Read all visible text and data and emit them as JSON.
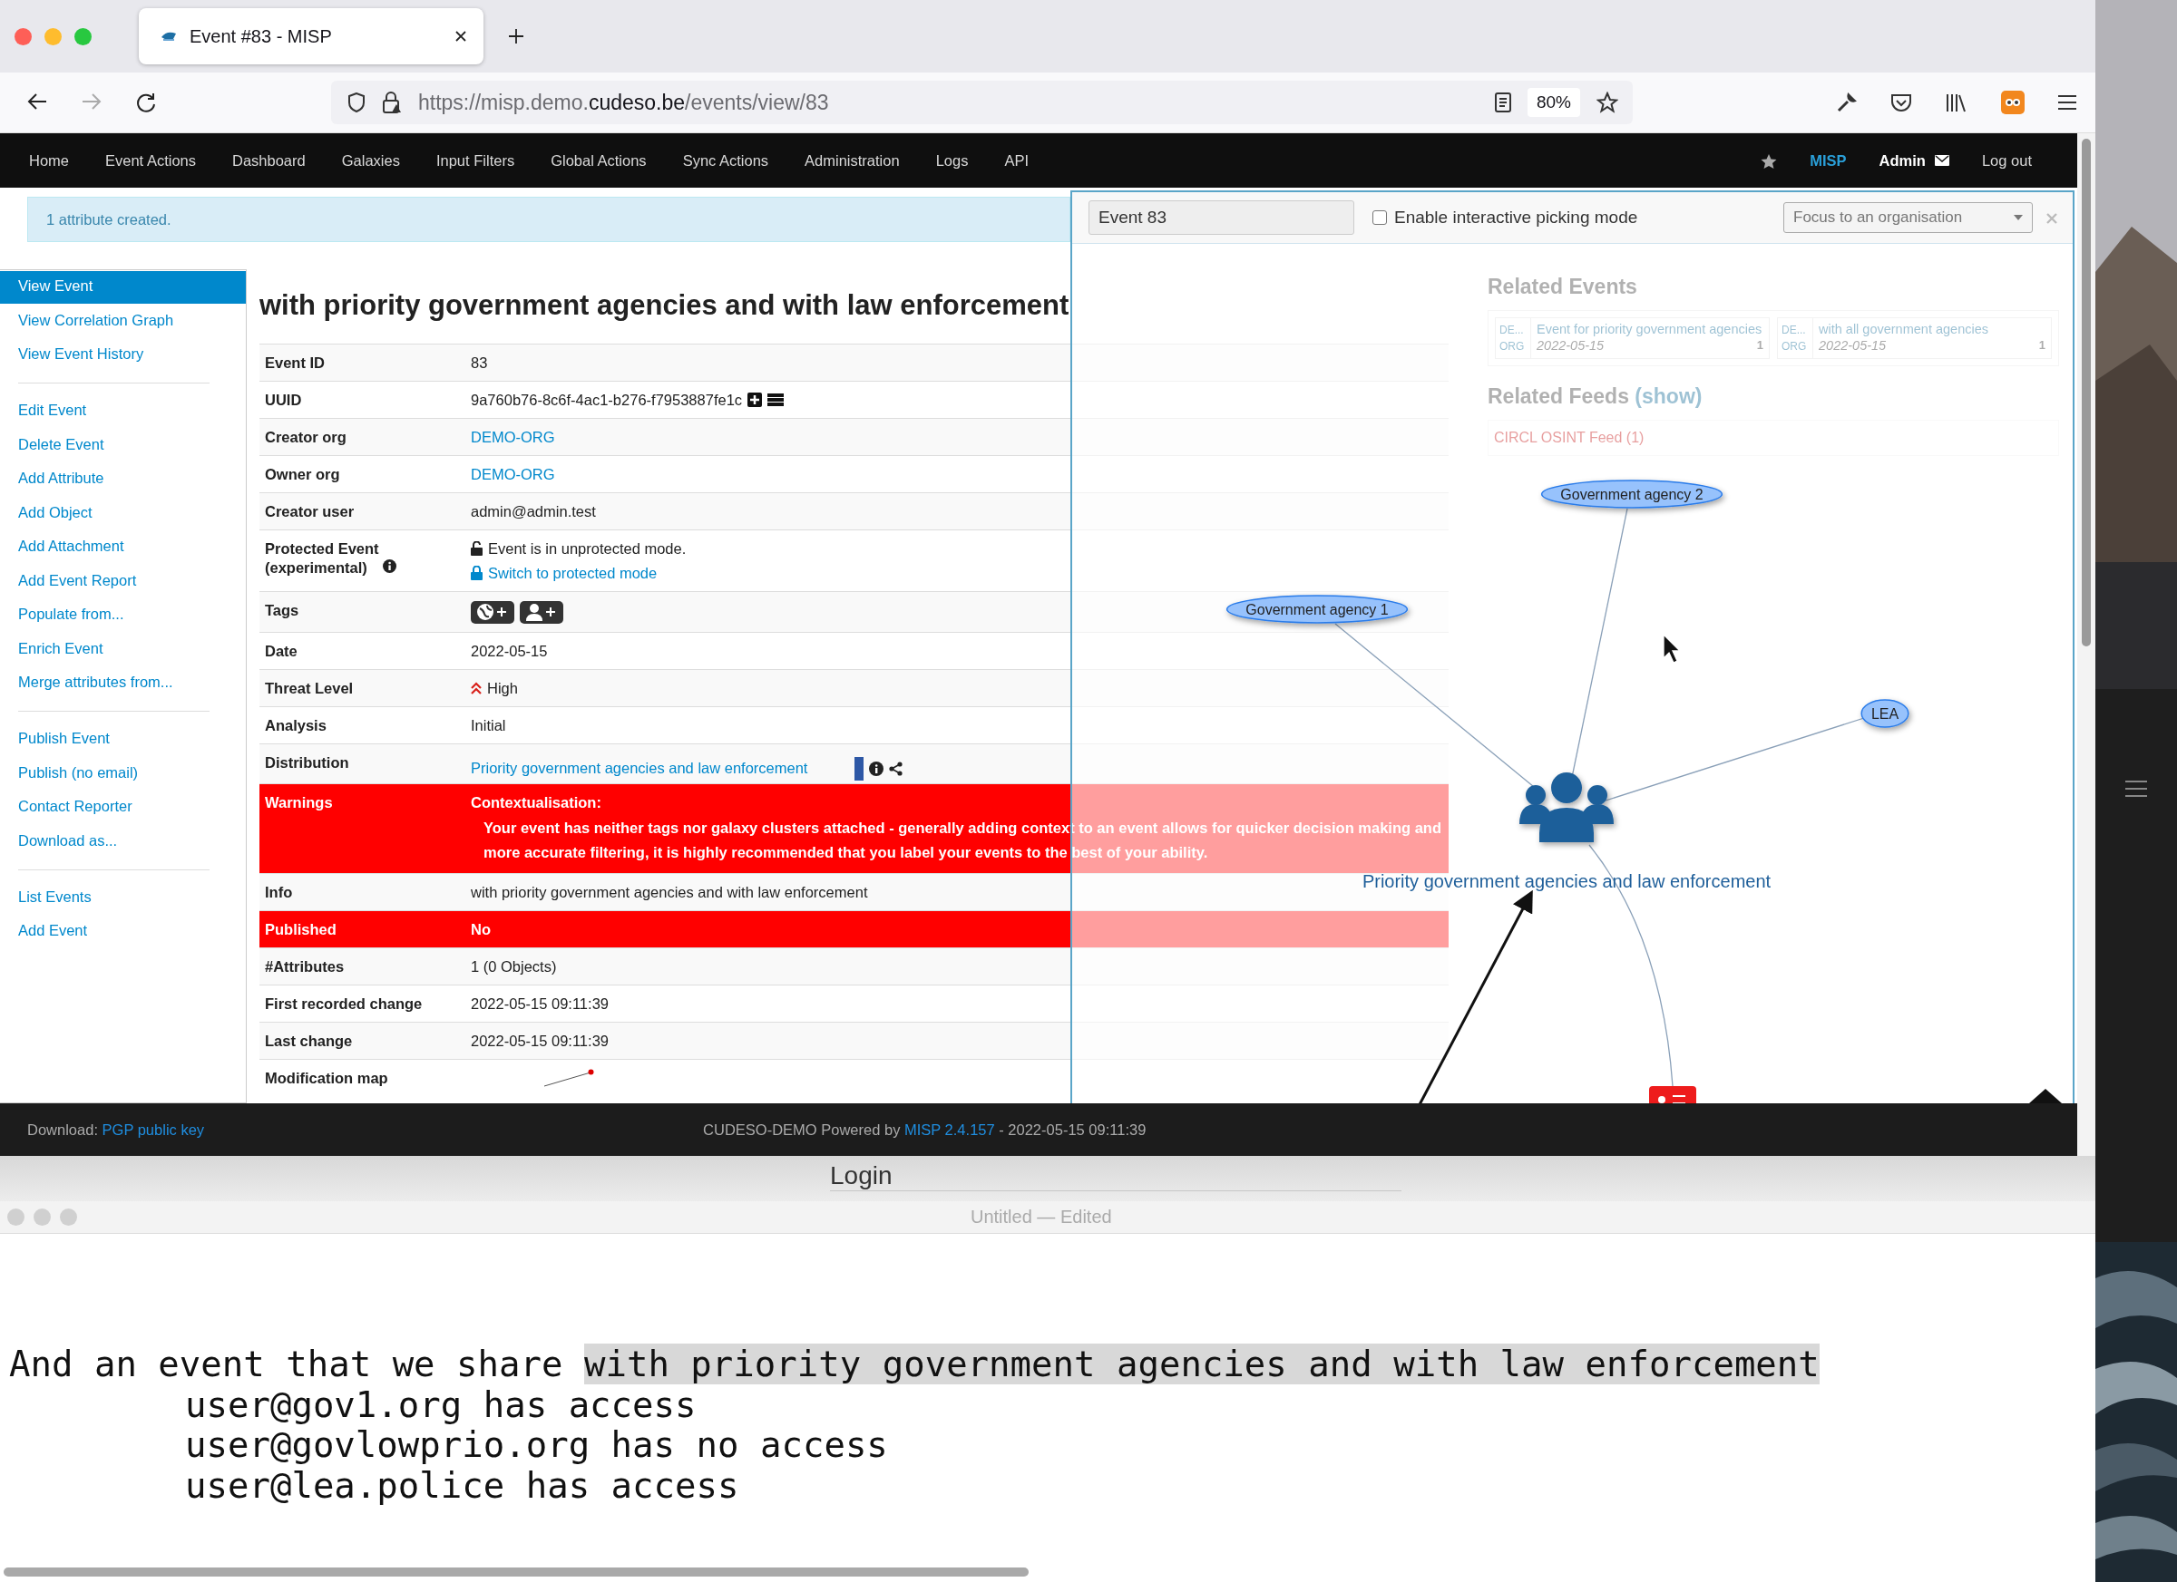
{
  "browser": {
    "tab_title": "Event #83 - MISP",
    "url": {
      "prefix": "https://misp.demo.",
      "domain": "cudeso.be",
      "path": "/events/view/83"
    },
    "zoom": "80%"
  },
  "navbar": {
    "items": [
      "Home",
      "Event Actions",
      "Dashboard",
      "Galaxies",
      "Input Filters",
      "Global Actions",
      "Sync Actions",
      "Administration",
      "Logs",
      "API"
    ],
    "brand": "MISP",
    "user": "Admin",
    "logout": "Log out"
  },
  "alert": "1 attribute created.",
  "sidebar": {
    "groups": [
      [
        {
          "label": "View Event",
          "selected": true
        },
        {
          "label": "View Correlation Graph",
          "selected": false
        },
        {
          "label": "View Event History",
          "selected": false
        }
      ],
      [
        {
          "label": "Edit Event",
          "selected": false
        },
        {
          "label": "Delete Event",
          "selected": false
        },
        {
          "label": "Add Attribute",
          "selected": false
        },
        {
          "label": "Add Object",
          "selected": false
        },
        {
          "label": "Add Attachment",
          "selected": false
        },
        {
          "label": "Add Event Report",
          "selected": false
        },
        {
          "label": "Populate from...",
          "selected": false
        },
        {
          "label": "Enrich Event",
          "selected": false
        },
        {
          "label": "Merge attributes from...",
          "selected": false
        }
      ],
      [
        {
          "label": "Publish Event",
          "selected": false
        },
        {
          "label": "Publish (no email)",
          "selected": false
        },
        {
          "label": "Contact Reporter",
          "selected": false
        },
        {
          "label": "Download as...",
          "selected": false
        }
      ],
      [
        {
          "label": "List Events",
          "selected": false
        },
        {
          "label": "Add Event",
          "selected": false
        }
      ]
    ]
  },
  "event": {
    "title": "with priority government agencies and with law enforcement",
    "rows": [
      {
        "kind": "text",
        "label": "Event ID",
        "value": "83",
        "highlight": false
      },
      {
        "kind": "uuid",
        "label": "UUID",
        "value": "9a760b76-8c6f-4ac1-b276-f7953887fe1c",
        "highlight": false
      },
      {
        "kind": "link",
        "label": "Creator org",
        "value": "DEMO-ORG",
        "highlight": false
      },
      {
        "kind": "link",
        "label": "Owner org",
        "value": "DEMO-ORG",
        "highlight": false
      },
      {
        "kind": "text",
        "label": "Creator user",
        "value": "admin@admin.test",
        "highlight": false
      },
      {
        "kind": "protected",
        "label": "Protected Event",
        "note": "(experimental)",
        "value": "Event is in unprotected mode.",
        "action": "Switch to protected mode",
        "highlight": false
      },
      {
        "kind": "tags",
        "label": "Tags",
        "highlight": false
      },
      {
        "kind": "text",
        "label": "Date",
        "value": "2022-05-15",
        "highlight": false
      },
      {
        "kind": "threat",
        "label": "Threat Level",
        "value": "High",
        "highlight": false
      },
      {
        "kind": "text",
        "label": "Analysis",
        "value": "Initial",
        "highlight": false
      },
      {
        "kind": "distribution",
        "label": "Distribution",
        "value": "Priority government agencies and law enforcement",
        "highlight": false
      },
      {
        "kind": "warning",
        "label": "Warnings",
        "heading": "Contextualisation:",
        "value": "Your event has neither tags nor galaxy clusters attached - generally adding context to an event allows for quicker decision making and more accurate filtering, it is highly recommended that you label your events to the best of your ability.",
        "highlight": true
      },
      {
        "kind": "text",
        "label": "Info",
        "value": "with priority government agencies and with law enforcement",
        "highlight": false
      },
      {
        "kind": "text",
        "label": "Published",
        "value": "No",
        "highlight": true
      },
      {
        "kind": "text",
        "label": "#Attributes",
        "value": "1 (0 Objects)",
        "highlight": false
      },
      {
        "kind": "text",
        "label": "First recorded change",
        "value": "2022-05-15 09:11:39",
        "highlight": false
      },
      {
        "kind": "text",
        "label": "Last change",
        "value": "2022-05-15 09:11:39",
        "highlight": false
      },
      {
        "kind": "map",
        "label": "Modification map",
        "highlight": false
      }
    ]
  },
  "related": {
    "title": "Related Events",
    "events": [
      {
        "org_lines": [
          "DE...",
          "ORG"
        ],
        "title": "Event for priority government agencies",
        "date": "2022-05-15",
        "count": "1"
      },
      {
        "org_lines": [
          "DE...",
          "ORG"
        ],
        "title": "with all government agencies",
        "date": "2022-05-15",
        "count": "1"
      }
    ],
    "feeds_title": "Related Feeds",
    "feeds_toggle": "(show)",
    "feeds": [
      "CIRCL OSINT Feed (1)"
    ]
  },
  "graph": {
    "search": "Event 83",
    "picking": {
      "label": "Enable interactive picking mode",
      "checked": false
    },
    "focus_placeholder": "Focus to an organisation",
    "nodes": [
      {
        "kind": "org",
        "label": "Government agency 2"
      },
      {
        "kind": "org",
        "label": "Government agency 1"
      },
      {
        "kind": "org",
        "label": "LEA"
      },
      {
        "kind": "group",
        "label": "Priority government agencies and law enforcement"
      },
      {
        "kind": "event"
      }
    ]
  },
  "footer": {
    "download_label": "Download:",
    "download_link": "PGP public key",
    "credit_prefix": "CUDESO-DEMO Powered by",
    "credit_link": "MISP 2.4.157",
    "credit_suffix": "- 2022-05-15 09:11:39"
  },
  "login_window": {
    "title": "Login"
  },
  "text_editor": {
    "title": "Untitled — Edited",
    "lines": [
      {
        "text": "And an event that we share ",
        "selected_text": "with priority government agencies and with law enforcement",
        "indented": false
      },
      {
        "text": "user@gov1.org has access",
        "indented": true
      },
      {
        "text": "user@govlowprio.org has no access",
        "indented": true
      },
      {
        "text": "user@lea.police has access",
        "indented": true
      }
    ]
  }
}
